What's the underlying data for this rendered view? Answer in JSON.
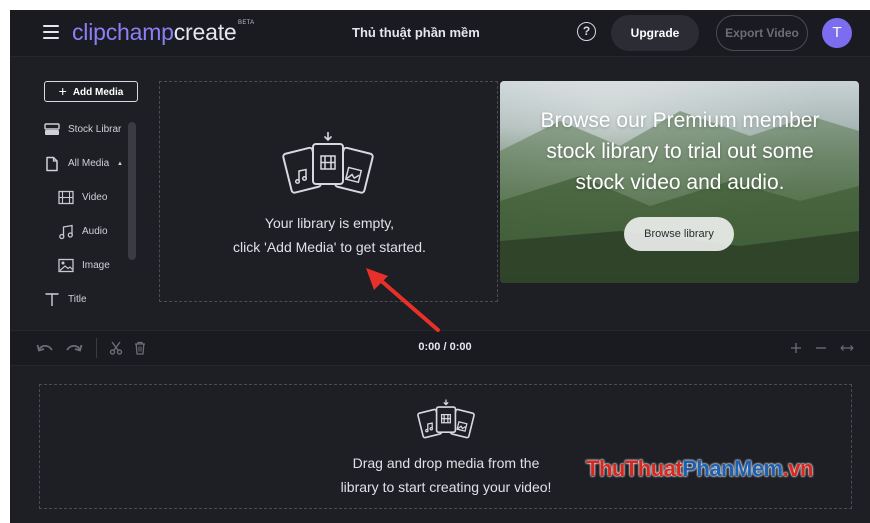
{
  "header": {
    "brand_part1": "clipchamp",
    "brand_part2": "create",
    "beta_label": "BETA",
    "project_title": "Thủ thuật phần mềm",
    "help_label": "?",
    "upgrade_label": "Upgrade",
    "export_label": "Export Video",
    "avatar_initial": "T"
  },
  "sidebar": {
    "add_media_label": "Add Media",
    "items": [
      {
        "label": "Stock Librar",
        "icon": "stock-library-icon"
      },
      {
        "label": "All Media",
        "icon": "file-icon",
        "chevron": "▲"
      },
      {
        "label": "Video",
        "icon": "film-icon"
      },
      {
        "label": "Audio",
        "icon": "music-note-icon"
      },
      {
        "label": "Image",
        "icon": "image-icon"
      },
      {
        "label": "Title",
        "icon": "title-t-icon"
      }
    ]
  },
  "library": {
    "empty_line1": "Your library is empty,",
    "empty_line2": "click 'Add Media' to get started."
  },
  "banner": {
    "line1": "Browse our Premium member",
    "line2": "stock library to trial out some",
    "line3": "stock video and audio.",
    "button_label": "Browse library"
  },
  "toolbar": {
    "timecode": "0:00 / 0:00"
  },
  "timeline": {
    "line1": "Drag and drop media from the",
    "line2": "library to start creating your video!"
  },
  "watermark": {
    "part1": "ThuThuat",
    "part2": "PhanMem",
    "part3": ".vn"
  },
  "colors": {
    "accent": "#7b6cf0",
    "brand_purple": "#8c7ef5",
    "background": "#1e1f25",
    "annotation_arrow": "#e8302a"
  }
}
